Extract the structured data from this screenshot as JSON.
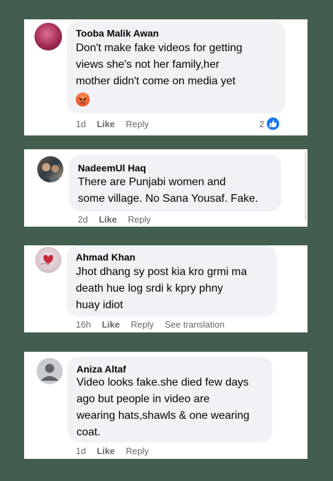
{
  "comments": [
    {
      "author": "Tooba Malik Awan",
      "text": "Don't make fake videos for getting\nviews she's not her family,her\nmother didn't come on media yet",
      "emoji": "angry-emoji",
      "time": "1d",
      "like_label": "Like",
      "reply_label": "Reply",
      "reaction_count": "2",
      "reaction_icon": "like-reaction-icon"
    },
    {
      "author": "NadeemUl Haq",
      "text": "There are Punjabi women and\nsome village. No Sana Yousaf. Fake.",
      "time": "2d",
      "like_label": "Like",
      "reply_label": "Reply"
    },
    {
      "author": "Ahmad Khan",
      "text": "Jhot dhang sy post kia kro grmi ma\ndeath hue log srdi k kpry phny\nhuay idiot",
      "time": "16h",
      "like_label": "Like",
      "reply_label": "Reply",
      "translation_label": "See translation"
    },
    {
      "author": "Aniza Altaf",
      "text": "Video looks fake.she died few days\nago but people in video are\nwearing hats,shawls & one wearing\ncoat.",
      "time": "1d",
      "like_label": "Like",
      "reply_label": "Reply"
    }
  ],
  "colors": {
    "background": "#435e4e",
    "bubble": "#f0f2f5",
    "meta_text": "#65676b",
    "like_blue": "#1877f2"
  }
}
